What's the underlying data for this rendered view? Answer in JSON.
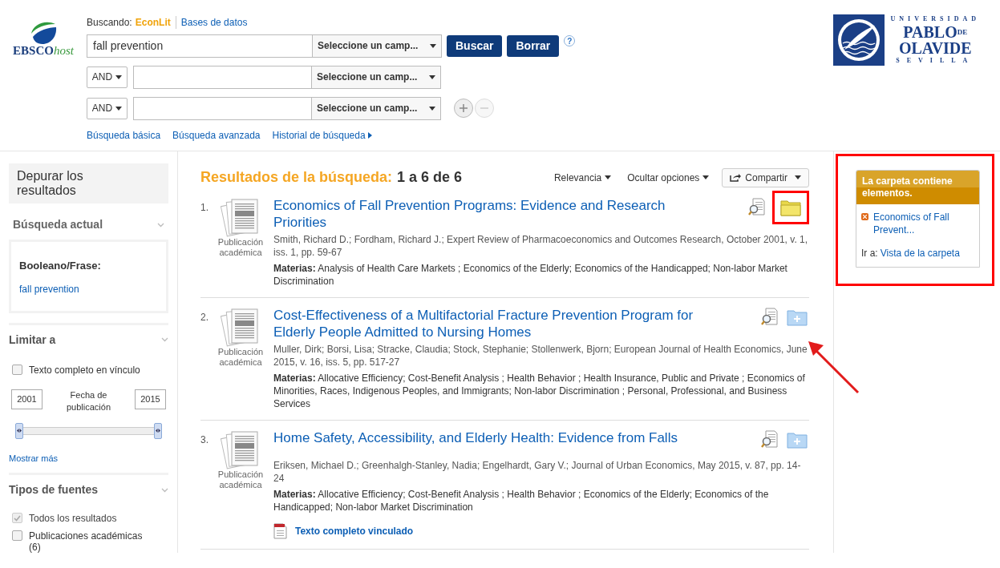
{
  "header": {
    "logo": {
      "main": "EBSCO",
      "suffix": "host"
    },
    "searching_label": "Buscando:",
    "database": "EconLit",
    "databases_link": "Bases de datos",
    "rows": [
      {
        "kind": "first",
        "value": "fall prevention",
        "field": "Seleccione un camp..."
      },
      {
        "kind": "bool",
        "operator": "AND",
        "value": "",
        "field": "Seleccione un camp..."
      },
      {
        "kind": "bool",
        "operator": "AND",
        "value": "",
        "field": "Seleccione un camp..."
      }
    ],
    "buttons": [
      "Buscar",
      "Borrar"
    ],
    "help": "?",
    "links": [
      {
        "label": "Búsqueda básica",
        "arrow": false
      },
      {
        "label": "Búsqueda avanzada",
        "arrow": false
      },
      {
        "label": "Historial de búsqueda",
        "arrow": true
      }
    ],
    "university": [
      "UNIVERSIDAD",
      "PABLO",
      "DE",
      "OLAVIDE",
      "SEVILLA"
    ]
  },
  "sidebar": {
    "title": "Depurar los resultados",
    "current_search": {
      "heading": "Búsqueda actual",
      "label": "Booleano/Frase:",
      "term": "fall prevention"
    },
    "limit": {
      "heading": "Limitar a",
      "checkbox": {
        "label": "Texto completo en vínculo",
        "checked": false
      },
      "from": "2001",
      "to": "2015",
      "date_label": "Fecha de publicación",
      "thumbs": [
        {
          "level": 0
        },
        {
          "level": 1
        }
      ],
      "more": "Mostrar más"
    },
    "source_types": {
      "heading": "Tipos de fuentes",
      "options": [
        {
          "label": "Todos los resultados",
          "checked": true,
          "disabled": true
        },
        {
          "label": "Publicaciones académicas (6)",
          "checked": false,
          "disabled": false
        }
      ]
    }
  },
  "results": {
    "heading": "Resultados de la búsqueda:",
    "range": "1 a 6 de 6",
    "sort": "Relevancia",
    "options": "Ocultar opciones",
    "share": "Compartir",
    "items": [
      {
        "number": "1.",
        "type": "Publicación académica",
        "title": "Economics of Fall Prevention Programs: Evidence and Research Priorities",
        "source": "Smith, Richard D.; Fordham, Richard J.; Expert Review of Pharmacoeconomics and Outcomes Research, October 2001, v. 1, iss. 1, pp. 59-67",
        "subjects_label": "Materias:",
        "subjects": "Analysis of Health Care Markets ; Economics of the Elderly; Economics of the Handicapped; Non-labor Market Discrimination",
        "in_folder": true,
        "highlighted": true
      },
      {
        "number": "2.",
        "type": "Publicación académica",
        "title": "Cost-Effectiveness of a Multifactorial Fracture Prevention Program for Elderly People Admitted to Nursing Homes",
        "source": "Muller, Dirk; Borsi, Lisa; Stracke, Claudia; Stock, Stephanie; Stollenwerk, Bjorn; European Journal of Health Economics, June 2015, v. 16, iss. 5, pp. 517-27",
        "subjects_label": "Materias:",
        "subjects": "Allocative Efficiency; Cost-Benefit Analysis ; Health Behavior ; Health Insurance, Public and Private ; Economics of Minorities, Races, Indigenous Peoples, and Immigrants; Non-labor Discrimination ; Personal, Professional, and Business Services",
        "in_folder": false,
        "highlighted": false
      },
      {
        "number": "3.",
        "type": "Publicación académica",
        "title": "Home Safety, Accessibility, and Elderly Health: Evidence from Falls",
        "source": "Eriksen, Michael D.; Greenhalgh-Stanley, Nadia; Engelhardt, Gary V.; Journal of Urban Economics, May 2015, v. 87, pp. 14-24",
        "subjects_label": "Materias:",
        "subjects": "Allocative Efficiency; Cost-Benefit Analysis ; Health Behavior ; Economics of the Elderly; Economics of the Handicapped; Non-labor Market Discrimination",
        "in_folder": false,
        "highlighted": false,
        "full_text": "Texto completo vinculado"
      }
    ]
  },
  "folder_panel": {
    "title": "La carpeta contiene elementos.",
    "items": [
      "Economics of Fall Prevent..."
    ],
    "goto_label": "Ir a:",
    "goto_link": "Vista de la carpeta",
    "highlighted": true
  }
}
